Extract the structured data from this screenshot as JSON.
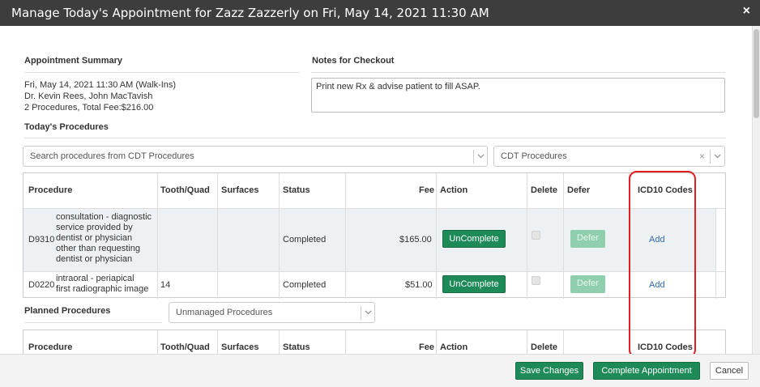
{
  "dialog": {
    "title": "Manage Today's Appointment for Zazz Zazzerly on Fri, May 14, 2021 11:30 AM",
    "close_glyph": "×"
  },
  "summary": {
    "heading": "Appointment Summary",
    "line1": "Fri, May 14, 2021 11:30 AM (Walk-Ins)",
    "line2": "Dr. Kevin Rees, John MacTavish",
    "line3": "2 Procedures, Total Fee:$216.00"
  },
  "notes": {
    "heading": "Notes for Checkout",
    "value": "Print new Rx & advise patient to fill ASAP."
  },
  "todays": {
    "heading": "Today's Procedures",
    "search_placeholder": "Search procedures from CDT Procedures",
    "catalog_value": "CDT Procedures",
    "columns": [
      "Procedure",
      "Tooth/Quad",
      "Surfaces",
      "Status",
      "Fee",
      "Action",
      "Delete",
      "Defer",
      "ICD10 Codes"
    ],
    "rows": [
      {
        "code": "D9310",
        "desc_lines": [
          "consultation - diagnostic",
          "service provided by",
          "dentist or physician",
          "other than requesting",
          "dentist or physician"
        ],
        "tooth": "",
        "surfaces": "",
        "status": "Completed",
        "fee": "$165.00",
        "action": "UnComplete",
        "defer": "Defer",
        "icd": "Add"
      },
      {
        "code": "D0220",
        "desc_lines": [
          "intraoral - periapical",
          "first radiographic image"
        ],
        "tooth": "14",
        "surfaces": "",
        "status": "Completed",
        "fee": "$51.00",
        "action": "UnComplete",
        "defer": "Defer",
        "icd": "Add"
      }
    ]
  },
  "planned": {
    "heading": "Planned Procedures",
    "filter_value": "Unmanaged Procedures",
    "columns": [
      "Procedure",
      "Tooth/Quad",
      "Surfaces",
      "Status",
      "Fee",
      "Action",
      "Delete",
      "ICD10 Codes"
    ]
  },
  "footer": {
    "save": "Save Changes",
    "complete": "Complete Appointment",
    "cancel": "Cancel"
  },
  "colors": {
    "titlebar": "#3d3d3d",
    "primary_green": "#1e8a57",
    "disabled_green": "#8fcfae",
    "link": "#2b6aa6",
    "highlight_red": "#e02020"
  }
}
